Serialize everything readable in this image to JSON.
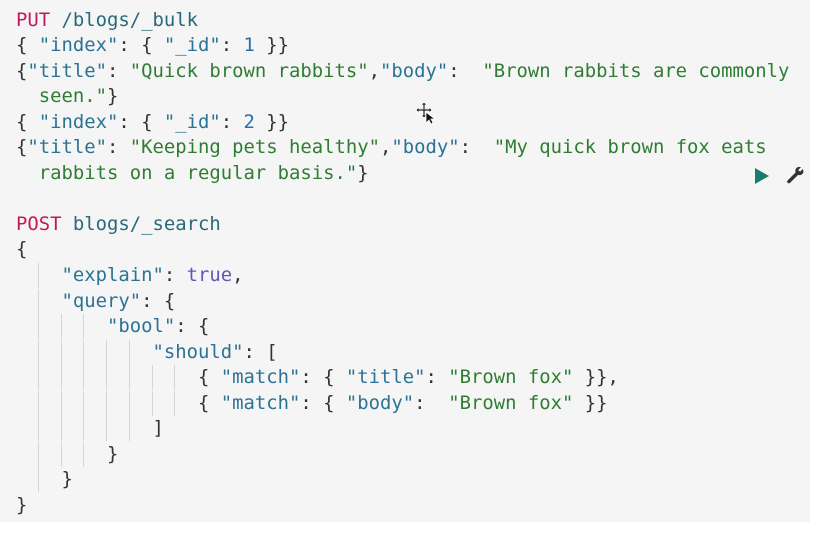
{
  "colors": {
    "method": "#c2185b",
    "url": "#27697a",
    "key": "#2a7394",
    "string": "#2e7d32",
    "number": "#2a6fa8",
    "boolean": "#6554b0",
    "background": "#f5f5f5",
    "run_button": "#1b7a6e"
  },
  "icons": {
    "run": "play-icon",
    "settings": "wrench-icon",
    "cursor": "move-cursor-icon"
  },
  "lines": [
    {
      "row": 0,
      "indent": 0,
      "tokens": [
        [
          "method",
          "PUT"
        ],
        [
          "url",
          " /blogs/_bulk"
        ]
      ]
    },
    {
      "row": 1,
      "indent": 0,
      "tokens": [
        [
          "punc",
          "{ "
        ],
        [
          "key",
          "\"index\""
        ],
        [
          "punc",
          ": { "
        ],
        [
          "key",
          "\"_id\""
        ],
        [
          "punc",
          ": "
        ],
        [
          "num",
          "1"
        ],
        [
          "punc",
          " }}"
        ]
      ]
    },
    {
      "row": 2,
      "indent": 0,
      "tokens": [
        [
          "punc",
          "{"
        ],
        [
          "key",
          "\"title\""
        ],
        [
          "punc",
          ": "
        ],
        [
          "str",
          "\"Quick brown rabbits\""
        ],
        [
          "punc",
          ","
        ],
        [
          "key",
          "\"body\""
        ],
        [
          "punc",
          ":  "
        ],
        [
          "str",
          "\"Brown rabbits are commonly"
        ]
      ]
    },
    {
      "row": 3,
      "indent": 0,
      "tokens": [
        [
          "str",
          "  seen.\""
        ],
        [
          "punc",
          "}"
        ]
      ]
    },
    {
      "row": 4,
      "indent": 0,
      "tokens": [
        [
          "punc",
          "{ "
        ],
        [
          "key",
          "\"index\""
        ],
        [
          "punc",
          ": { "
        ],
        [
          "key",
          "\"_id\""
        ],
        [
          "punc",
          ": "
        ],
        [
          "num",
          "2"
        ],
        [
          "punc",
          " }}"
        ]
      ]
    },
    {
      "row": 5,
      "indent": 0,
      "tokens": [
        [
          "punc",
          "{"
        ],
        [
          "key",
          "\"title\""
        ],
        [
          "punc",
          ": "
        ],
        [
          "str",
          "\"Keeping pets healthy\""
        ],
        [
          "punc",
          ","
        ],
        [
          "key",
          "\"body\""
        ],
        [
          "punc",
          ":  "
        ],
        [
          "str",
          "\"My quick brown fox eats"
        ]
      ]
    },
    {
      "row": 6,
      "indent": 0,
      "tokens": [
        [
          "str",
          "  rabbits on a regular basis.\""
        ],
        [
          "punc",
          "}"
        ]
      ]
    },
    {
      "row": 8,
      "indent": 0,
      "tokens": [
        [
          "method",
          "POST"
        ],
        [
          "url",
          " blogs/_search"
        ]
      ]
    },
    {
      "row": 9,
      "indent": 0,
      "tokens": [
        [
          "punc",
          "{"
        ]
      ]
    },
    {
      "row": 10,
      "indent": 1,
      "tokens": [
        [
          "punc",
          "    "
        ],
        [
          "key",
          "\"explain\""
        ],
        [
          "punc",
          ": "
        ],
        [
          "bool",
          "true"
        ],
        [
          "punc",
          ","
        ]
      ]
    },
    {
      "row": 11,
      "indent": 1,
      "tokens": [
        [
          "punc",
          "    "
        ],
        [
          "key",
          "\"query\""
        ],
        [
          "punc",
          ": {"
        ]
      ]
    },
    {
      "row": 12,
      "indent": 3,
      "tokens": [
        [
          "punc",
          "        "
        ],
        [
          "key",
          "\"bool\""
        ],
        [
          "punc",
          ": {"
        ]
      ]
    },
    {
      "row": 13,
      "indent": 5,
      "tokens": [
        [
          "punc",
          "            "
        ],
        [
          "key",
          "\"should\""
        ],
        [
          "punc",
          ": ["
        ]
      ]
    },
    {
      "row": 14,
      "indent": 7,
      "tokens": [
        [
          "punc",
          "                { "
        ],
        [
          "key",
          "\"match\""
        ],
        [
          "punc",
          ": { "
        ],
        [
          "key",
          "\"title\""
        ],
        [
          "punc",
          ": "
        ],
        [
          "str",
          "\"Brown fox\""
        ],
        [
          "punc",
          " }},"
        ]
      ]
    },
    {
      "row": 15,
      "indent": 7,
      "tokens": [
        [
          "punc",
          "                { "
        ],
        [
          "key",
          "\"match\""
        ],
        [
          "punc",
          ": { "
        ],
        [
          "key",
          "\"body\""
        ],
        [
          "punc",
          ":  "
        ],
        [
          "str",
          "\"Brown fox\""
        ],
        [
          "punc",
          " }}"
        ]
      ]
    },
    {
      "row": 16,
      "indent": 5,
      "tokens": [
        [
          "punc",
          "            ]"
        ]
      ]
    },
    {
      "row": 17,
      "indent": 3,
      "tokens": [
        [
          "punc",
          "        }"
        ]
      ]
    },
    {
      "row": 18,
      "indent": 1,
      "tokens": [
        [
          "punc",
          "    }"
        ]
      ]
    },
    {
      "row": 19,
      "indent": 0,
      "tokens": [
        [
          "punc",
          "}"
        ]
      ]
    }
  ]
}
